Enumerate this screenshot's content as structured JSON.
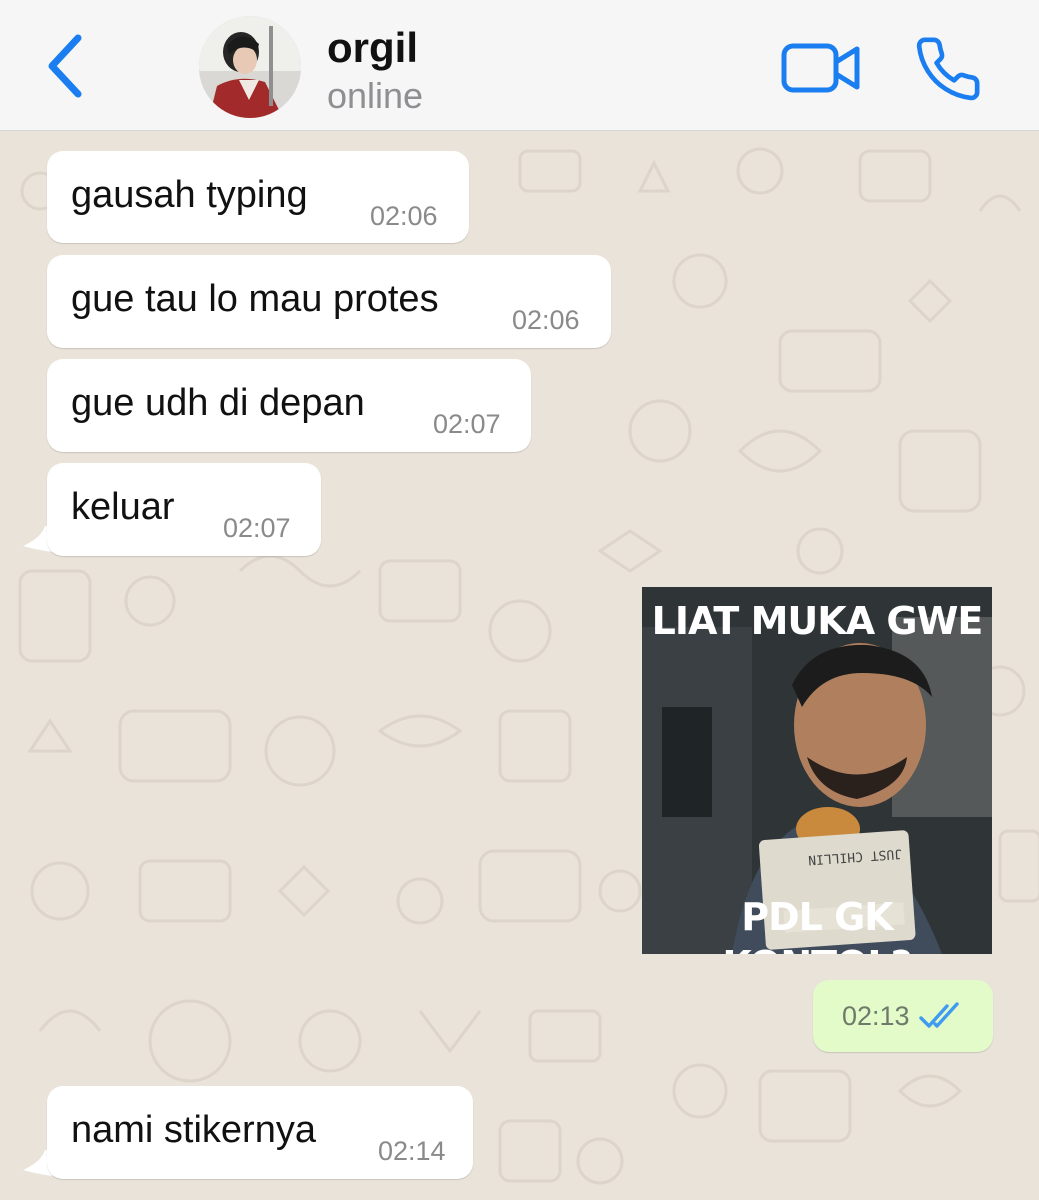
{
  "header": {
    "contact_name": "orgil",
    "contact_status": "online"
  },
  "messages": [
    {
      "text": "gausah typing",
      "time": "02:06"
    },
    {
      "text": "gue tau lo mau protes",
      "time": "02:06"
    },
    {
      "text": "gue udh di depan",
      "time": "02:07"
    },
    {
      "text": "keluar",
      "time": "02:07"
    },
    {
      "text": "nami stikernya",
      "time": "02:14"
    }
  ],
  "sticker": {
    "top_caption": "LIAT MUKA GWE",
    "bottom_caption": "PDL GK KONTOL?",
    "package_text": "JUST CHILLIN"
  },
  "outgoing": {
    "time": "02:13",
    "status_icon": "double-check-read-icon"
  },
  "colors": {
    "accent": "#1a7df0",
    "read_receipt": "#3f9bf0",
    "outgoing_bubble": "#e2fbc9",
    "incoming_bubble": "#ffffff",
    "chat_background": "#e9e3da"
  }
}
